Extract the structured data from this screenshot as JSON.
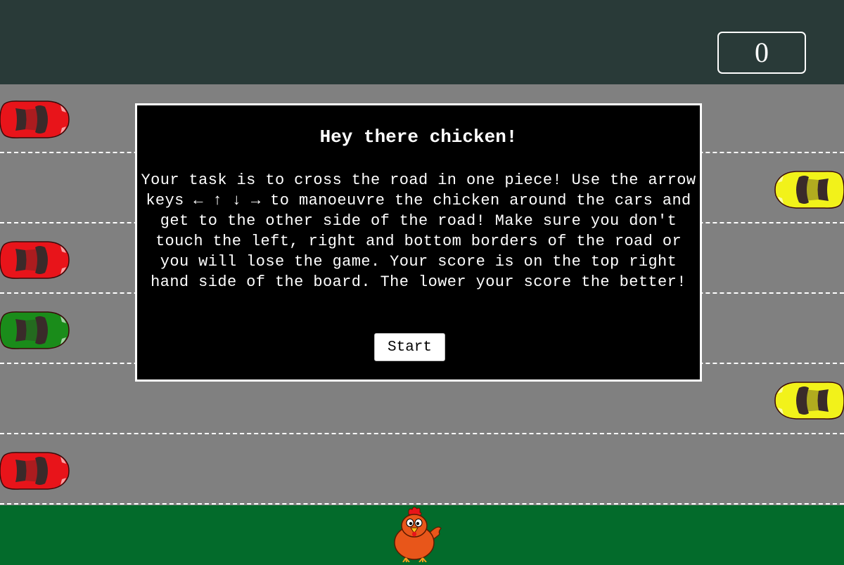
{
  "score": {
    "value": "0"
  },
  "modal": {
    "title": "Hey there chicken!",
    "body": "Your task is to cross the road in one piece! Use the arrow keys ← ↑ ↓ → to manoeuvre the chicken around the cars and get to the other side of the road! Make sure you don't touch the left, right and bottom borders of the road or you will lose the game. Your score is on the top right hand side of the board. The lower your score the better!",
    "start_label": "Start"
  },
  "colors": {
    "topbar": "#293a38",
    "road": "#808080",
    "grass": "#036b2b",
    "car_red": "#e8141a",
    "car_yellow": "#f2f21a",
    "car_green": "#1a8c1a",
    "chicken": "#e8561a"
  },
  "cars": [
    {
      "color": "red",
      "direction": "right"
    },
    {
      "color": "yellow",
      "direction": "left"
    },
    {
      "color": "red",
      "direction": "right"
    },
    {
      "color": "green",
      "direction": "right"
    },
    {
      "color": "yellow",
      "direction": "left"
    },
    {
      "color": "red",
      "direction": "right"
    }
  ]
}
